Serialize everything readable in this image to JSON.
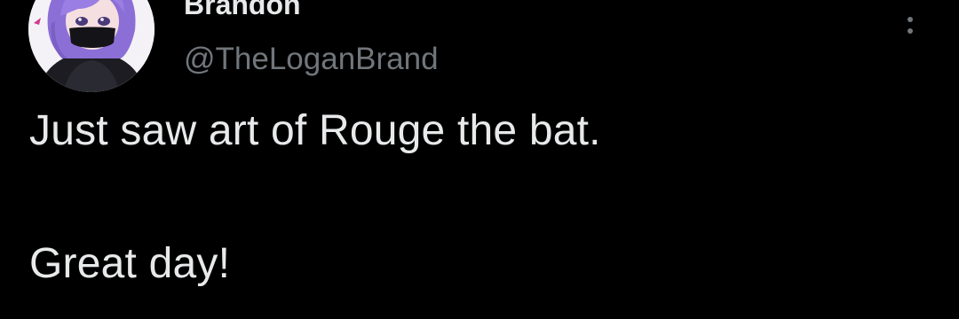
{
  "tweet": {
    "author": {
      "display_name": "Brandon",
      "handle": "@TheLoganBrand",
      "avatar_icon": "avatar-purple-hair-masked-character"
    },
    "more_icon": "more-vertical-icon",
    "text_lines": [
      "Just saw art of Rouge the bat.",
      "Great day!"
    ]
  },
  "colors": {
    "background": "#000000",
    "primary_text": "#e7e9ea",
    "secondary_text": "#71767b",
    "avatar_hair": "#8b6fd6"
  }
}
